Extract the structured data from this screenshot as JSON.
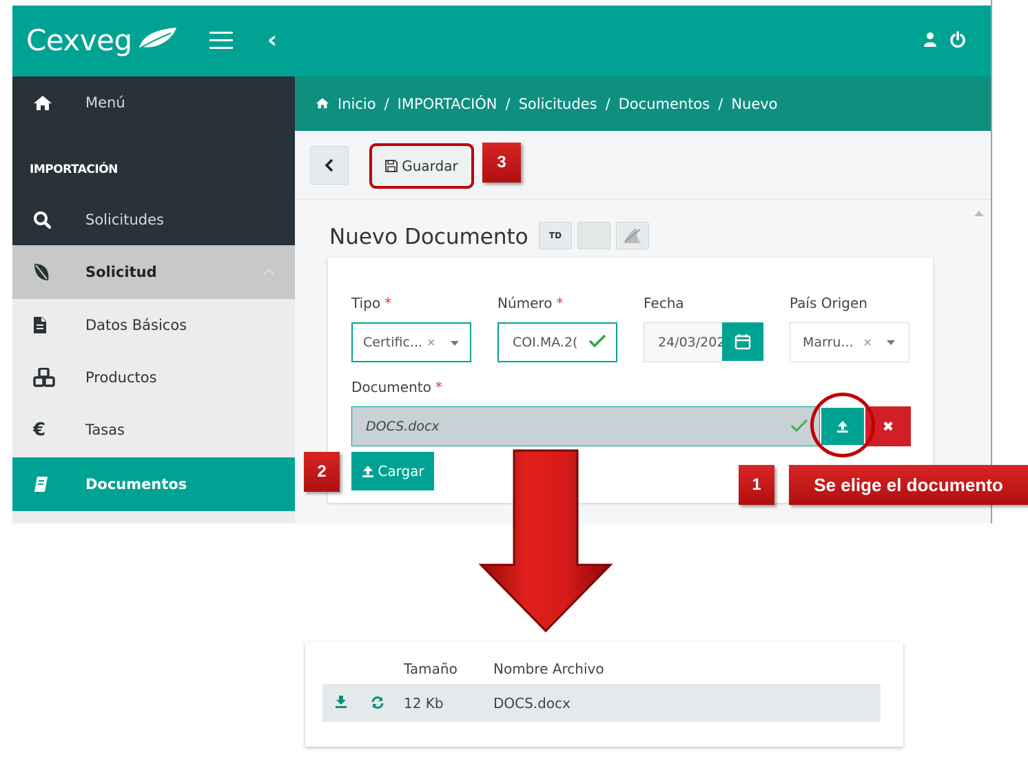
{
  "app": {
    "logo_text": "Cexveg",
    "brand_color": "#00a393",
    "dark_color": "#283339",
    "danger_color": "#d21f26"
  },
  "sidebar": {
    "menu_label": "Menú",
    "section_title": "IMPORTACIÓN",
    "items": [
      {
        "label": "Solicitudes",
        "icon": "search-icon"
      },
      {
        "label": "Solicitud",
        "icon": "leaf-icon",
        "expanded": true
      },
      {
        "label": "Datos Básicos",
        "icon": "file-icon"
      },
      {
        "label": "Productos",
        "icon": "cubes-icon"
      },
      {
        "label": "Tasas",
        "icon": "euro-icon"
      },
      {
        "label": "Documentos",
        "icon": "book-icon",
        "active": true
      }
    ]
  },
  "breadcrumb": [
    "Inicio",
    "IMPORTACIÓN",
    "Solicitudes",
    "Documentos",
    "Nuevo"
  ],
  "toolbar": {
    "save_label": "Guardar"
  },
  "page": {
    "title": "Nuevo Documento",
    "td_label": "TD"
  },
  "form": {
    "tipo": {
      "label": "Tipo",
      "value": "Certific...",
      "required": "*"
    },
    "numero": {
      "label": "Número",
      "value": "COI.MA.2(",
      "required": "*"
    },
    "fecha": {
      "label": "Fecha",
      "value": "24/03/202"
    },
    "pais": {
      "label": "País Origen",
      "value": "Marru..."
    },
    "documento": {
      "label": "Documento",
      "value": "DOCS.docx",
      "required": "*"
    },
    "cargar_label": "Cargar"
  },
  "annotations": {
    "step1": "1",
    "step1_text": "Se elige el documento",
    "step2": "2",
    "step3": "3"
  },
  "result_table": {
    "columns": [
      "Tamaño",
      "Nombre Archivo"
    ],
    "rows": [
      {
        "size": "12 Kb",
        "name": "DOCS.docx"
      }
    ]
  }
}
